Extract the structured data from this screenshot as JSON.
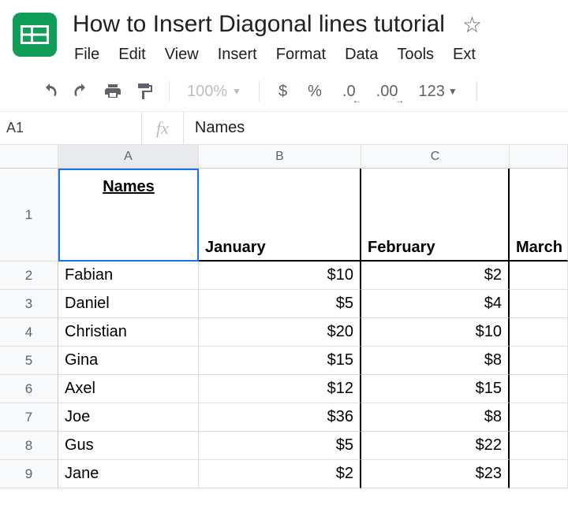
{
  "doc": {
    "title": "How to Insert Diagonal lines tutorial"
  },
  "menu": {
    "file": "File",
    "edit": "Edit",
    "view": "View",
    "insert": "Insert",
    "format": "Format",
    "data": "Data",
    "tools": "Tools",
    "ext": "Ext"
  },
  "toolbar": {
    "zoom": "100%",
    "currency": "$",
    "percent": "%",
    "dec_less": ".0",
    "dec_more": ".00",
    "numfmt": "123"
  },
  "formula": {
    "name_box": "A1",
    "fx_label": "fx",
    "value": "Names"
  },
  "columns": {
    "A": "A",
    "B": "B",
    "C": "C",
    "D": ""
  },
  "header_row": {
    "names": "Names",
    "b": "January",
    "c": "February",
    "d": "March"
  },
  "rownums": {
    "r1": "1",
    "r2": "2",
    "r3": "3",
    "r4": "4",
    "r5": "5",
    "r6": "6",
    "r7": "7",
    "r8": "8",
    "r9": "9"
  },
  "data": {
    "r2": {
      "a": "Fabian",
      "b": "$10",
      "c": "$2"
    },
    "r3": {
      "a": "Daniel",
      "b": "$5",
      "c": "$4"
    },
    "r4": {
      "a": "Christian",
      "b": "$20",
      "c": "$10"
    },
    "r5": {
      "a": "Gina",
      "b": "$15",
      "c": "$8"
    },
    "r6": {
      "a": "Axel",
      "b": "$12",
      "c": "$15"
    },
    "r7": {
      "a": "Joe",
      "b": "$36",
      "c": "$8"
    },
    "r8": {
      "a": "Gus",
      "b": "$5",
      "c": "$22"
    },
    "r9": {
      "a": "Jane",
      "b": "$2",
      "c": "$23"
    }
  }
}
